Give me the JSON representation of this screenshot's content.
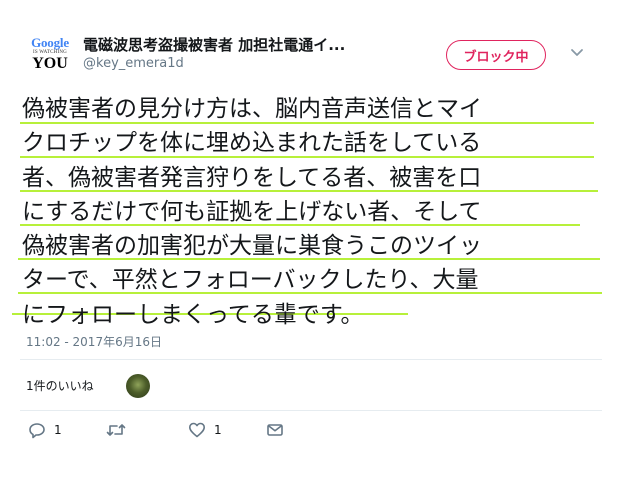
{
  "author": {
    "avatar_lines": [
      "Google",
      "IS WATCHING",
      "YOU"
    ],
    "display_name": "電磁波思考盗撮被害者 加担社電通イ...",
    "screen_name": "@key_emera1d"
  },
  "header": {
    "block_button_label": "ブロック中"
  },
  "tweet": {
    "lines": [
      "偽被害者の見分け方は、脳内音声送信とマイ",
      "クロチップを体に埋め込まれた話をしている",
      "者、偽被害者発言狩りをしてる者、被害を口",
      "にするだけで何も証拠を上げない者、そして",
      "偽被害者の加害犯が大量に巣食うこのツイッ",
      "ターで、平然とフォローバックしたり、大量",
      "にフォローしまくってる輩です。"
    ],
    "timestamp": "11:02 - 2017年6月16日"
  },
  "stats": {
    "likes_label": "1件のいいね"
  },
  "actions": {
    "reply_count": "1",
    "like_count": "1"
  },
  "colors": {
    "accent": "#e0245e",
    "highlight": "#b7f03a",
    "muted": "#657786"
  },
  "icons": [
    "chevron-down-icon",
    "reply-icon",
    "retweet-icon",
    "like-icon",
    "direct-message-icon"
  ]
}
